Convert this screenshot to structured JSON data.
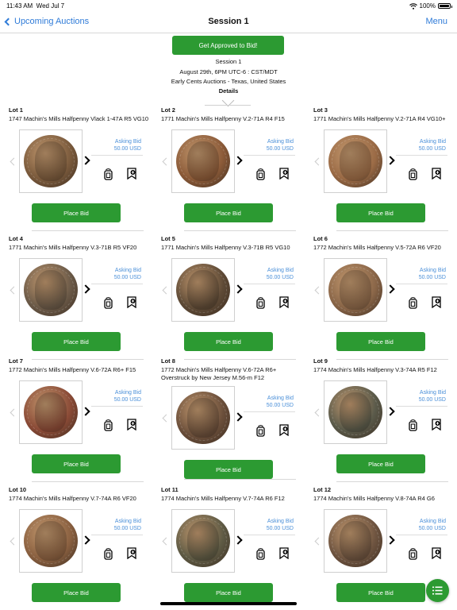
{
  "status": {
    "time": "11:43 AM",
    "date": "Wed Jul 7",
    "battery": "100%"
  },
  "nav": {
    "back_label": "Upcoming Auctions",
    "title": "Session 1",
    "menu_label": "Menu"
  },
  "session": {
    "approve_label": "Get Approved to Bid!",
    "name": "Session 1",
    "date": "August 29th, 6PM UTC-6 : CST/MDT",
    "location": "Early Cents Auctions - Texas, United States",
    "details_label": "Details"
  },
  "lots": [
    {
      "label": "Lot 1",
      "desc": "1747 Machin's Mills Halfpenny Vlack 1-47A R5 VG10",
      "ask_label": "Asking Bid",
      "ask_value": "50.00 USD",
      "bid_label": "Place Bid",
      "coin_color": "#7a5a3c"
    },
    {
      "label": "Lot 2",
      "desc": "1771 Machin's Mills Halfpenny V.2-71A R4 F15",
      "ask_label": "Asking Bid",
      "ask_value": "50.00 USD",
      "bid_label": "Place Bid",
      "coin_color": "#8b5a38"
    },
    {
      "label": "Lot 3",
      "desc": "1771 Machin's Mills Halfpenny V.2-71A R4 VG10+",
      "ask_label": "Asking Bid",
      "ask_value": "50.00 USD",
      "bid_label": "Place Bid",
      "coin_color": "#9a6a45"
    },
    {
      "label": "Lot 4",
      "desc": "1771 Machin's Mills Halfpenny V.3-71B R5 VF20",
      "ask_label": "Asking Bid",
      "ask_value": "50.00 USD",
      "bid_label": "Place Bid",
      "coin_color": "#6b5a48"
    },
    {
      "label": "Lot 5",
      "desc": "1771 Machin's Mills Halfpenny V.3-71B R5 VG10",
      "ask_label": "Asking Bid",
      "ask_value": "50.00 USD",
      "bid_label": "Place Bid",
      "coin_color": "#5e4a36"
    },
    {
      "label": "Lot 6",
      "desc": "1772 Machin's Mills Halfpenny V.5-72A R6 VF20",
      "ask_label": "Asking Bid",
      "ask_value": "50.00 USD",
      "bid_label": "Place Bid",
      "coin_color": "#8a6648"
    },
    {
      "label": "Lot 7",
      "desc": "1772 Machin's Mills Halfpenny V.6-72A R6+ F15",
      "ask_label": "Asking Bid",
      "ask_value": "50.00 USD",
      "bid_label": "Place Bid",
      "coin_color": "#8a4a36"
    },
    {
      "label": "Lot 8",
      "desc": "1772 Machin's Mills Halfpenny V.6-72A R6+ Overstruck by New Jersey M.56-m F12",
      "ask_label": "Asking Bid",
      "ask_value": "50.00 USD",
      "bid_label": "Place Bid",
      "coin_color": "#6a4e3a"
    },
    {
      "label": "Lot 9",
      "desc": "1774 Machin's Mills Halfpenny V.3-74A R5 F12",
      "ask_label": "Asking Bid",
      "ask_value": "50.00 USD",
      "bid_label": "Place Bid",
      "coin_color": "#5a5a4a"
    },
    {
      "label": "Lot 10",
      "desc": "1774 Machin's Mills Halfpenny V.7-74A R6 VF20",
      "ask_label": "Asking Bid",
      "ask_value": "50.00 USD",
      "bid_label": "Place Bid",
      "coin_color": "#8a6040"
    },
    {
      "label": "Lot 11",
      "desc": "1774 Machin's Mills Halfpenny V.7-74A R6 F12",
      "ask_label": "Asking Bid",
      "ask_value": "50.00 USD",
      "bid_label": "Place Bid",
      "coin_color": "#5e5a44"
    },
    {
      "label": "Lot 12",
      "desc": "1774 Machin's Mills Halfpenny V.8-74A R4 G6",
      "ask_label": "Asking Bid",
      "ask_value": "50.00 USD",
      "bid_label": "Place Bid",
      "coin_color": "#6e5440"
    }
  ],
  "icons": {
    "back": "chevron-left-icon",
    "wifi": "wifi-icon",
    "battery": "battery-icon",
    "prev": "chevron-left-icon",
    "next": "chevron-right-icon",
    "mobile": "mobile-bid-icon",
    "watch": "bookmark-add-icon",
    "fab": "list-icon"
  },
  "colors": {
    "accent": "#2c9a32",
    "link": "#2f7bd8",
    "ask": "#4a8fd8"
  }
}
